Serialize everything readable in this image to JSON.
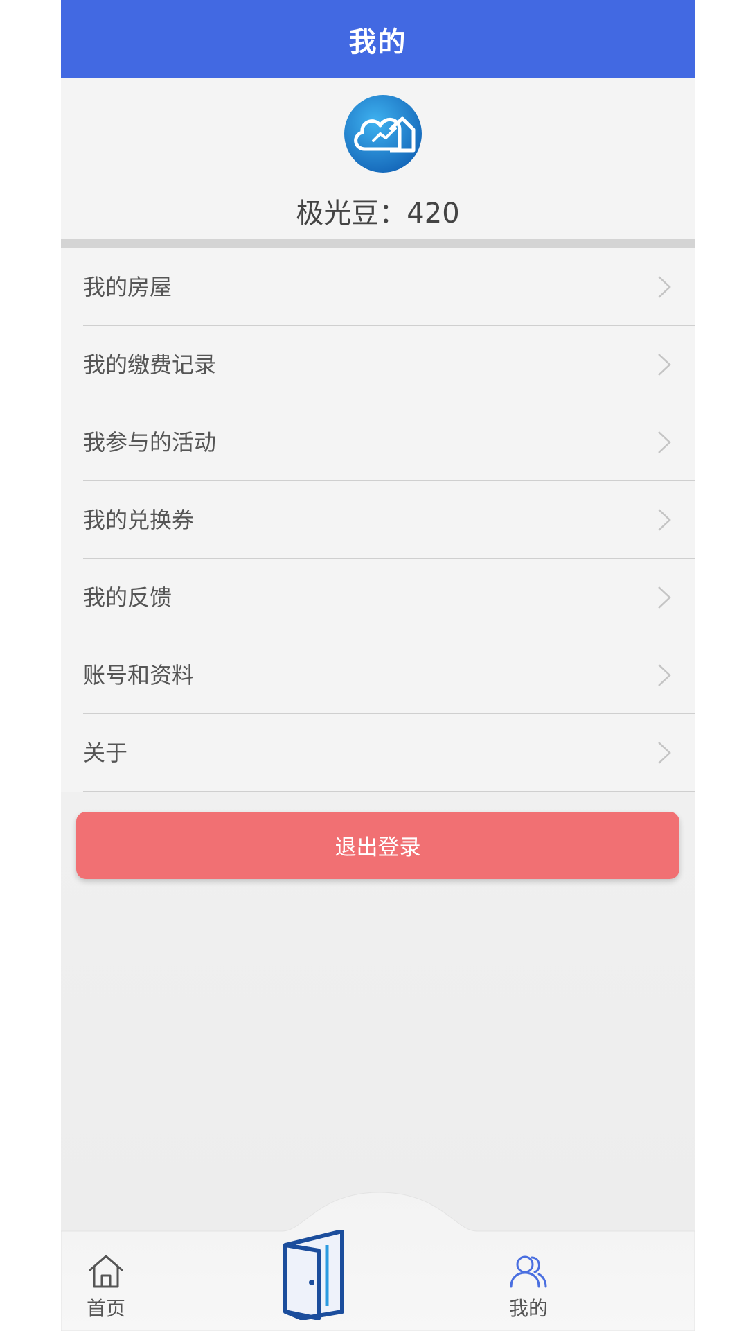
{
  "header": {
    "title": "我的"
  },
  "profile": {
    "points_text": "极光豆：420"
  },
  "menu": {
    "items": [
      {
        "label": "我的房屋"
      },
      {
        "label": "我的缴费记录"
      },
      {
        "label": "我参与的活动"
      },
      {
        "label": "我的兑换券"
      },
      {
        "label": "我的反馈"
      },
      {
        "label": "账号和资料"
      },
      {
        "label": "关于"
      }
    ]
  },
  "logout": {
    "label": "退出登录"
  },
  "tabbar": {
    "tabs": [
      {
        "label": "首页",
        "icon": "home-icon"
      },
      {
        "label": "",
        "icon": "door-icon"
      },
      {
        "label": "我的",
        "icon": "users-icon",
        "selected": true
      }
    ]
  },
  "colors": {
    "header": "#4269e2",
    "logout": "#f17073",
    "tab_active_icon": "#4a6fe0",
    "logo_blue": "#1f8fd8"
  }
}
